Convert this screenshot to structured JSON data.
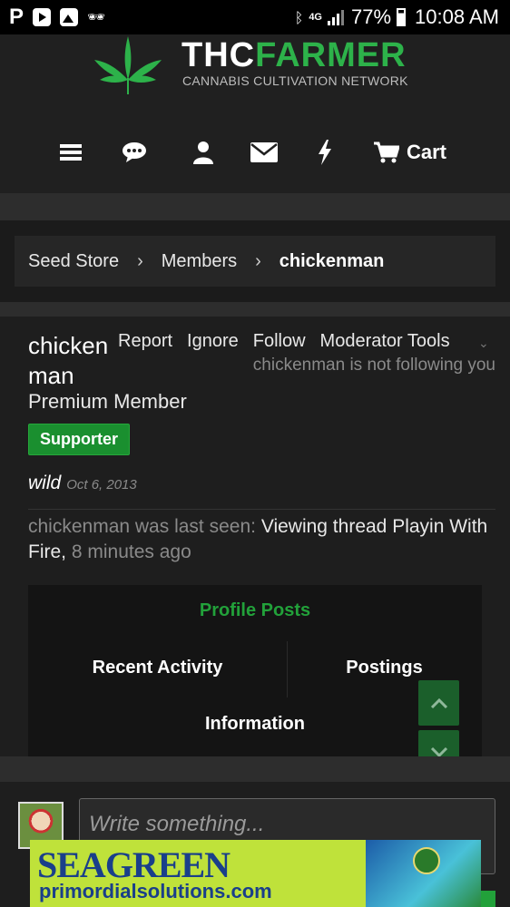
{
  "status_bar": {
    "left_icons": [
      "pandora-icon",
      "youtube-icon",
      "image-icon",
      "incognito-icon"
    ],
    "network": "4G",
    "battery": "77%",
    "time": "10:08 AM"
  },
  "header": {
    "logo_word1": "THC",
    "logo_word2": "FARMER",
    "logo_subtitle": "CANNABIS CULTIVATION NETWORK",
    "cart_label": "Cart",
    "colors": {
      "brand_green": "#2db24a"
    }
  },
  "breadcrumb": {
    "items": [
      "Seed Store",
      "Members"
    ],
    "current": "chickenman"
  },
  "profile": {
    "username": "chickenman",
    "actions": [
      "Report",
      "Ignore",
      "Follow",
      "Moderator Tools"
    ],
    "follow_status": "chickenman is not following you",
    "user_title": "Premium Member",
    "badge": "Supporter",
    "status": "wild",
    "status_date": "Oct 6, 2013",
    "last_seen_prefix": "chickenman was last seen:",
    "last_seen_activity": "Viewing thread Playin With Fire,",
    "last_seen_time": "8 minutes ago"
  },
  "tabs": {
    "profile_posts": "Profile Posts",
    "recent_activity": "Recent Activity",
    "postings": "Postings",
    "information": "Information"
  },
  "composer": {
    "placeholder": "Write something..."
  },
  "ad": {
    "title": "SEAGREEN",
    "url": "primordialsolutions.com"
  }
}
